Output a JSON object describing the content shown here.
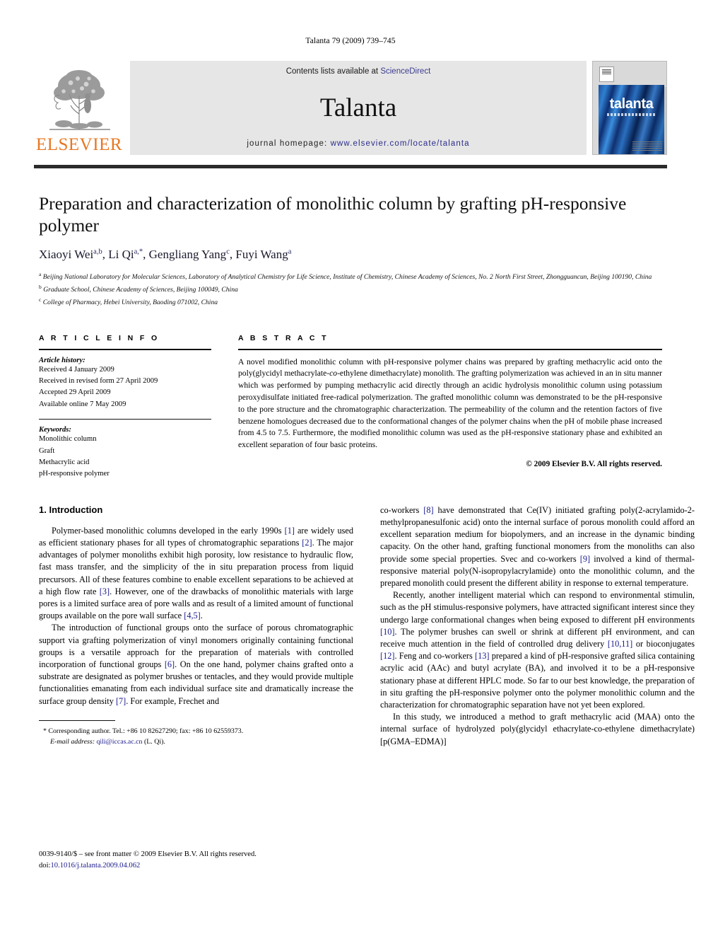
{
  "running_head": "Talanta 79 (2009) 739–745",
  "masthead": {
    "publisher_logo_name": "elsevier-tree-logo",
    "publisher_word": "ELSEVIER",
    "contents_prefix": "Contents lists available at ",
    "contents_link": "ScienceDirect",
    "journal_name": "Talanta",
    "homepage_prefix": "journal homepage: ",
    "homepage_url": "www.elsevier.com/locate/talanta",
    "cover_title": "talanta"
  },
  "article": {
    "title": "Preparation and characterization of monolithic column by grafting pH-responsive polymer",
    "authors_html": "Xiaoyi Wei<sup>a,b</sup>, Li Qi<sup>a,*</sup>, Gengliang Yang<sup>c</sup>, Fuyi Wang<sup>a</sup>",
    "affiliations": [
      "Beijing National Laboratory for Molecular Sciences, Laboratory of Analytical Chemistry for Life Science, Institute of Chemistry, Chinese Academy of Sciences, No. 2 North First Street, Zhongguancun, Beijing 100190, China",
      "Graduate School, Chinese Academy of Sciences, Beijing 100049, China",
      "College of Pharmacy, Hebei University, Baoding 071002, China"
    ],
    "affiliation_marks": [
      "a",
      "b",
      "c"
    ]
  },
  "article_info": {
    "label": "A R T I C L E  I N F O",
    "history_heading": "Article history:",
    "history": [
      "Received 4 January 2009",
      "Received in revised form 27 April 2009",
      "Accepted 29 April 2009",
      "Available online 7 May 2009"
    ],
    "keywords_heading": "Keywords:",
    "keywords": [
      "Monolithic column",
      "Graft",
      "Methacrylic acid",
      "pH-responsive polymer"
    ]
  },
  "abstract": {
    "label": "A B S T R A C T",
    "text_part1": "A novel modified monolithic column with pH-responsive polymer chains was prepared by grafting methacrylic acid onto the poly(glycidyl methacrylate-",
    "text_italic1": "co",
    "text_part2": "-ethylene dimethacrylate) monolith. The grafting polymerization was achieved in an in situ manner which was performed by pumping methacrylic acid directly through an acidic hydrolysis monolithic column using potassium peroxydisulfate initiated free-radical polymerization. The grafted monolithic column was demonstrated to be the pH-responsive to the pore structure and the chromatographic characterization. The permeability of the column and the retention factors of five benzene homologues decreased due to the conformational changes of the polymer chains when the pH of mobile phase increased from 4.5 to 7.5. Furthermore, the modified monolithic column was used as the pH-responsive stationary phase and exhibited an excellent separation of four basic proteins.",
    "copyright": "© 2009 Elsevier B.V. All rights reserved."
  },
  "introduction": {
    "heading": "1. Introduction",
    "left_paragraphs": [
      "Polymer-based monolithic columns developed in the early 1990s [1] are widely used as efficient stationary phases for all types of chromatographic separations [2]. The major advantages of polymer monoliths exhibit high porosity, low resistance to hydraulic flow, fast mass transfer, and the simplicity of the in situ preparation process from liquid precursors. All of these features combine to enable excellent separations to be achieved at a high flow rate [3]. However, one of the drawbacks of monolithic materials with large pores is a limited surface area of pore walls and as result of a limited amount of functional groups available on the pore wall surface [4,5].",
      "The introduction of functional groups onto the surface of porous chromatographic support via grafting polymerization of vinyl monomers originally containing functional groups is a versatile approach for the preparation of materials with controlled incorporation of functional groups [6]. On the one hand, polymer chains grafted onto a substrate are designated as polymer brushes or tentacles, and they would provide multiple functionalities emanating from each individual surface site and dramatically increase the surface group density [7]. For example, Frechet and"
    ],
    "right_paragraphs": [
      "co-workers [8] have demonstrated that Ce(IV) initiated grafting poly(2-acrylamido-2-methylpropanesulfonic acid) onto the internal surface of porous monolith could afford an excellent separation medium for biopolymers, and an increase in the dynamic binding capacity. On the other hand, grafting functional monomers from the monoliths can also provide some special properties. Svec and co-workers [9] involved a kind of thermal-responsive material poly(N-isopropylacrylamide) onto the monolithic column, and the prepared monolith could present the different ability in response to external temperature.",
      "Recently, another intelligent material which can respond to environmental stimulin, such as the pH stimulus-responsive polymers, have attracted significant interest since they undergo large conformational changes when being exposed to different pH environments [10]. The polymer brushes can swell or shrink at different pH environment, and can receive much attention in the field of controlled drug delivery [10,11] or bioconjugates [12]. Feng and co-workers [13] prepared a kind of pH-responsive grafted silica containing acrylic acid (AAc) and butyl acrylate (BA), and involved it to be a pH-responsive stationary phase at different HPLC mode. So far to our best knowledge, the preparation of in situ grafting the pH-responsive polymer onto the polymer monolithic column and the characterization for chromatographic separation have not yet been explored.",
      "In this study, we introduced a method to graft methacrylic acid (MAA) onto the internal surface of hydrolyzed poly(glycidyl ethacrylate-co-ethylene dimethacrylate) [p(GMA–EDMA)]"
    ]
  },
  "footnote": {
    "marker": "*",
    "text": "Corresponding author. Tel.: +86 10 82627290; fax: +86 10 62559373.",
    "email_label": "E-mail address:",
    "email": "qili@iccas.ac.cn",
    "email_owner": "(L. Qi)."
  },
  "footer": {
    "issn_line": "0039-9140/$ – see front matter © 2009 Elsevier B.V. All rights reserved.",
    "doi_label": "doi:",
    "doi": "10.1016/j.talanta.2009.04.062"
  }
}
